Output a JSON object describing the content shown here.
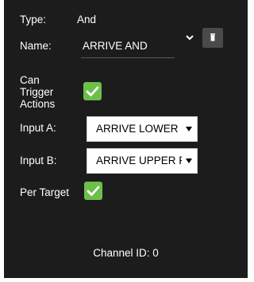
{
  "type_row": {
    "label": "Type:",
    "value": "And"
  },
  "name_row": {
    "label": "Name:",
    "value": "ARRIVE AND"
  },
  "trigger_actions": {
    "label_lines": [
      "Can",
      "Trigger",
      "Actions"
    ],
    "checked": true
  },
  "input_a": {
    "label": "Input A:",
    "selected": "ARRIVE LOWER RI"
  },
  "input_b": {
    "label": "Input B:",
    "selected": "ARRIVE UPPER RI("
  },
  "per_target": {
    "label": "Per Target",
    "checked": true
  },
  "footer": {
    "channel_id": "Channel ID: 0"
  },
  "colors": {
    "panel": "#1c1c1c",
    "checkbox": "#6cc04a",
    "button": "#4a4a4a"
  },
  "icons": {
    "expand": "chevron-down-icon",
    "delete": "trash-icon",
    "dropdown": "caret-down-icon",
    "check": "check-icon"
  }
}
